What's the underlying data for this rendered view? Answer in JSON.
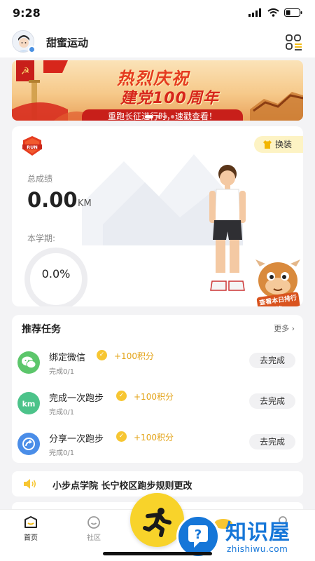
{
  "status_bar": {
    "time": "9:28"
  },
  "header": {
    "title": "甜蜜运动"
  },
  "banner": {
    "headline": "热烈庆祝",
    "subline": "建党100周年",
    "tagline": "重跑长征进行时，速戳查看！"
  },
  "stats": {
    "badge": "RUN",
    "outfit_label": "换装",
    "total_label": "总成绩",
    "total_value": "0.00",
    "total_unit": "KM",
    "term_label": "本学期:",
    "term_progress": "0.0%",
    "term_progress_value": 0,
    "ranking_label": "查看本日排行榜"
  },
  "tasks": {
    "title": "推荐任务",
    "more_label": "更多",
    "items": [
      {
        "name": "绑定微信",
        "points": "+100积分",
        "progress": "完成0/1",
        "button": "去完成",
        "icon": "wechat-icon",
        "color": "#5cc66b"
      },
      {
        "name": "完成一次跑步",
        "points": "+100积分",
        "progress": "完成0/1",
        "button": "去完成",
        "icon": "km-icon",
        "color": "#4cc38a"
      },
      {
        "name": "分享一次跑步",
        "points": "+100积分",
        "progress": "完成0/1",
        "button": "去完成",
        "icon": "share-icon",
        "color": "#4a8de8"
      }
    ]
  },
  "notice": {
    "text": "小步点学院 长宁校区跑步规则更改"
  },
  "tabs": [
    {
      "label": "首页",
      "active": true
    },
    {
      "label": "社区",
      "active": false
    }
  ],
  "watermark": {
    "title": "知识屋",
    "url": "zhishiwu.com"
  },
  "colors": {
    "accent": "#f8d32a",
    "banner_red": "#d7261b",
    "watermark_blue": "#1576d8"
  }
}
